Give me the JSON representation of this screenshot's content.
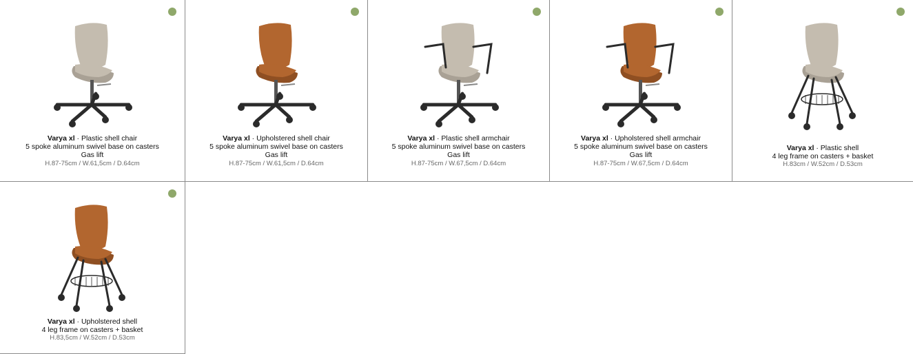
{
  "colors": {
    "status_dot": "#8fa86a",
    "plastic_shell": "#c4bcaf",
    "upholstered_shell": "#b2662f",
    "frame": "#2b2b2b"
  },
  "products": [
    {
      "model": "Varya xl",
      "separator": " · ",
      "type": "Plastic shell chair",
      "lines": [
        "5 spoke aluminum swivel base on casters",
        "Gas lift"
      ],
      "dims": "H.87-75cm / W.61,5cm / D.64cm",
      "shell": "plastic",
      "base": "swivel",
      "arms": false,
      "status_icon": "availability-dot"
    },
    {
      "model": "Varya xl",
      "separator": " · ",
      "type": "Upholstered shell chair",
      "lines": [
        "5 spoke aluminum swivel base on casters",
        "Gas lift"
      ],
      "dims": "H.87-75cm / W.61,5cm / D.64cm",
      "shell": "upholstered",
      "base": "swivel",
      "arms": false,
      "status_icon": "availability-dot"
    },
    {
      "model": "Varya xl",
      "separator": " · ",
      "type": "Plastic shell armchair",
      "lines": [
        "5 spoke aluminum swivel base on casters",
        "Gas lift"
      ],
      "dims": "H.87-75cm / W.67,5cm / D.64cm",
      "shell": "plastic",
      "base": "swivel",
      "arms": true,
      "status_icon": "availability-dot"
    },
    {
      "model": "Varya xl",
      "separator": " · ",
      "type": "Upholstered shell armchair",
      "lines": [
        "5 spoke aluminum swivel base on casters",
        "Gas lift"
      ],
      "dims": "H.87-75cm / W.67,5cm / D.64cm",
      "shell": "upholstered",
      "base": "swivel",
      "arms": true,
      "status_icon": "availability-dot"
    },
    {
      "model": "Varya xl",
      "separator": " · ",
      "type": "Plastic shell",
      "lines": [
        "4 leg frame on casters + basket"
      ],
      "dims": "H.83cm / W.52cm / D.53cm",
      "shell": "plastic",
      "base": "four-leg",
      "arms": false,
      "status_icon": "availability-dot"
    },
    {
      "model": "Varya xl",
      "separator": " · ",
      "type": "Upholstered shell",
      "lines": [
        "4 leg frame on casters + basket"
      ],
      "dims": "H.83,5cm / W.52cm / D.53cm",
      "shell": "upholstered",
      "base": "four-leg",
      "arms": false,
      "status_icon": "availability-dot"
    }
  ]
}
